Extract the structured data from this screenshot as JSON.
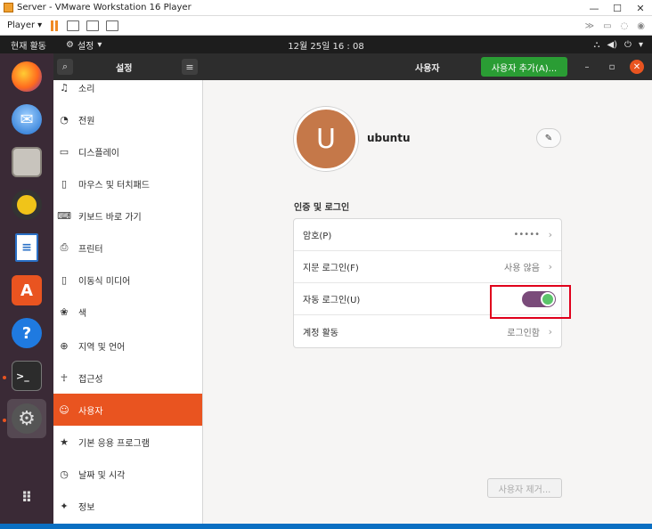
{
  "window": {
    "title": "Server - VMware Workstation 16 Player",
    "minimize": "—",
    "maximize": "☐",
    "close": "✕"
  },
  "vm_toolbar": {
    "player_label": "Player",
    "right_icons": [
      "≫",
      "▭",
      "◌",
      "◉"
    ]
  },
  "topbar": {
    "activities": "현재 활동",
    "app_menu": "설정",
    "clock": "12월 25일  16 : 08"
  },
  "header": {
    "sidebar_title": "설정",
    "page_title": "사용자",
    "add_user_button": "사용자 추가(A)..."
  },
  "sidebar": {
    "items": [
      {
        "label": "소리",
        "icon": "music-note-icon",
        "glyph": "♫"
      },
      {
        "label": "전원",
        "icon": "power-icon",
        "glyph": "◔"
      },
      {
        "label": "디스플레이",
        "icon": "display-icon",
        "glyph": "▭"
      },
      {
        "label": "마우스 및 터치패드",
        "icon": "mouse-icon",
        "glyph": "▯"
      },
      {
        "label": "키보드 바로 가기",
        "icon": "keyboard-icon",
        "glyph": "⌨"
      },
      {
        "label": "프린터",
        "icon": "printer-icon",
        "glyph": "⎙"
      },
      {
        "label": "이동식 미디어",
        "icon": "removable-media-icon",
        "glyph": "▯"
      },
      {
        "label": "색",
        "icon": "color-icon",
        "glyph": "❀"
      },
      {
        "label": "지역 및 언어",
        "icon": "globe-icon",
        "glyph": "⊕"
      },
      {
        "label": "접근성",
        "icon": "accessibility-icon",
        "glyph": "☥"
      },
      {
        "label": "사용자",
        "icon": "user-icon",
        "glyph": "☺"
      },
      {
        "label": "기본 응용 프로그램",
        "icon": "star-icon",
        "glyph": "★"
      },
      {
        "label": "날짜 및 시각",
        "icon": "clock-icon",
        "glyph": "◷"
      },
      {
        "label": "정보",
        "icon": "info-icon",
        "glyph": "✦"
      }
    ],
    "selected": "사용자"
  },
  "user": {
    "avatar_initial": "U",
    "name": "ubuntu"
  },
  "auth": {
    "section_title": "인증 및 로그인",
    "rows": [
      {
        "label": "암호(P)",
        "value": "•••••"
      },
      {
        "label": "지문 로그인(F)",
        "value": "사용 않음"
      },
      {
        "label": "자동 로그인(U)",
        "toggle": true
      },
      {
        "label": "계정 활동",
        "value": "로그인함"
      }
    ]
  },
  "remove_user_button": "사용자 제거...",
  "colors": {
    "accent": "#e95420",
    "add_button": "#2a9d34",
    "toggle_track": "#7a4b7a",
    "highlight_box": "#e0001b"
  }
}
